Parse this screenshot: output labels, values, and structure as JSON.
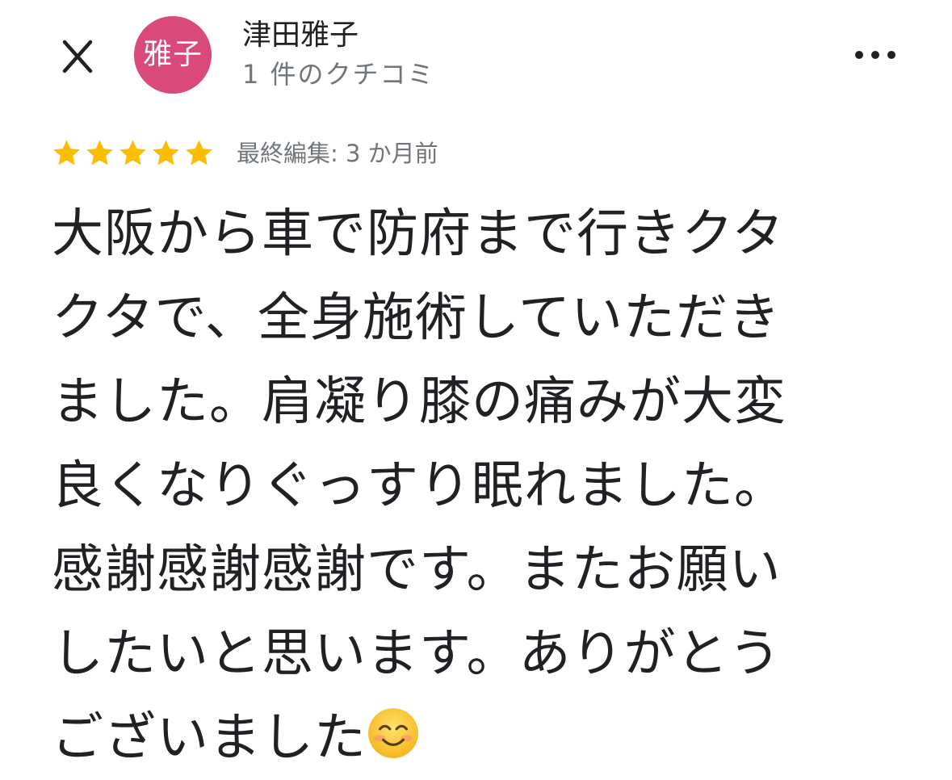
{
  "header": {
    "close_icon": "close-icon",
    "avatar_text": "雅子",
    "avatar_color": "#d9497a",
    "author_name": "津田雅子",
    "review_count": "1 件のクチコミ",
    "more_icon": "more-options-icon"
  },
  "rating": {
    "stars": 5,
    "max_stars": 5,
    "star_color": "#fbbc04",
    "edited_label": "最終編集: 3 か月前"
  },
  "review": {
    "lines": [
      "大阪から車で防府まで行きクタ",
      "クタで、全身施術していただき",
      "ました。肩凝り膝の痛みが大変",
      "良くなりぐっすり眠れました。",
      "感謝感謝感謝です。またお願い",
      "したいと思います。ありがとう",
      "ございました"
    ],
    "trailing_emoji": "smiling-face-emoji"
  }
}
